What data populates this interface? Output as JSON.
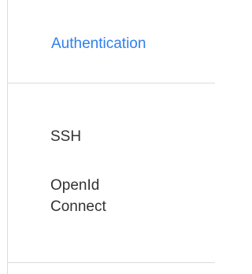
{
  "tabs": {
    "active_label": "Authentication"
  },
  "list": {
    "items": [
      {
        "label": "SSH"
      },
      {
        "label": "OpenId Connect"
      }
    ]
  },
  "colors": {
    "accent": "#2f80ed",
    "text": "#333333",
    "border": "#dcdcdc"
  }
}
